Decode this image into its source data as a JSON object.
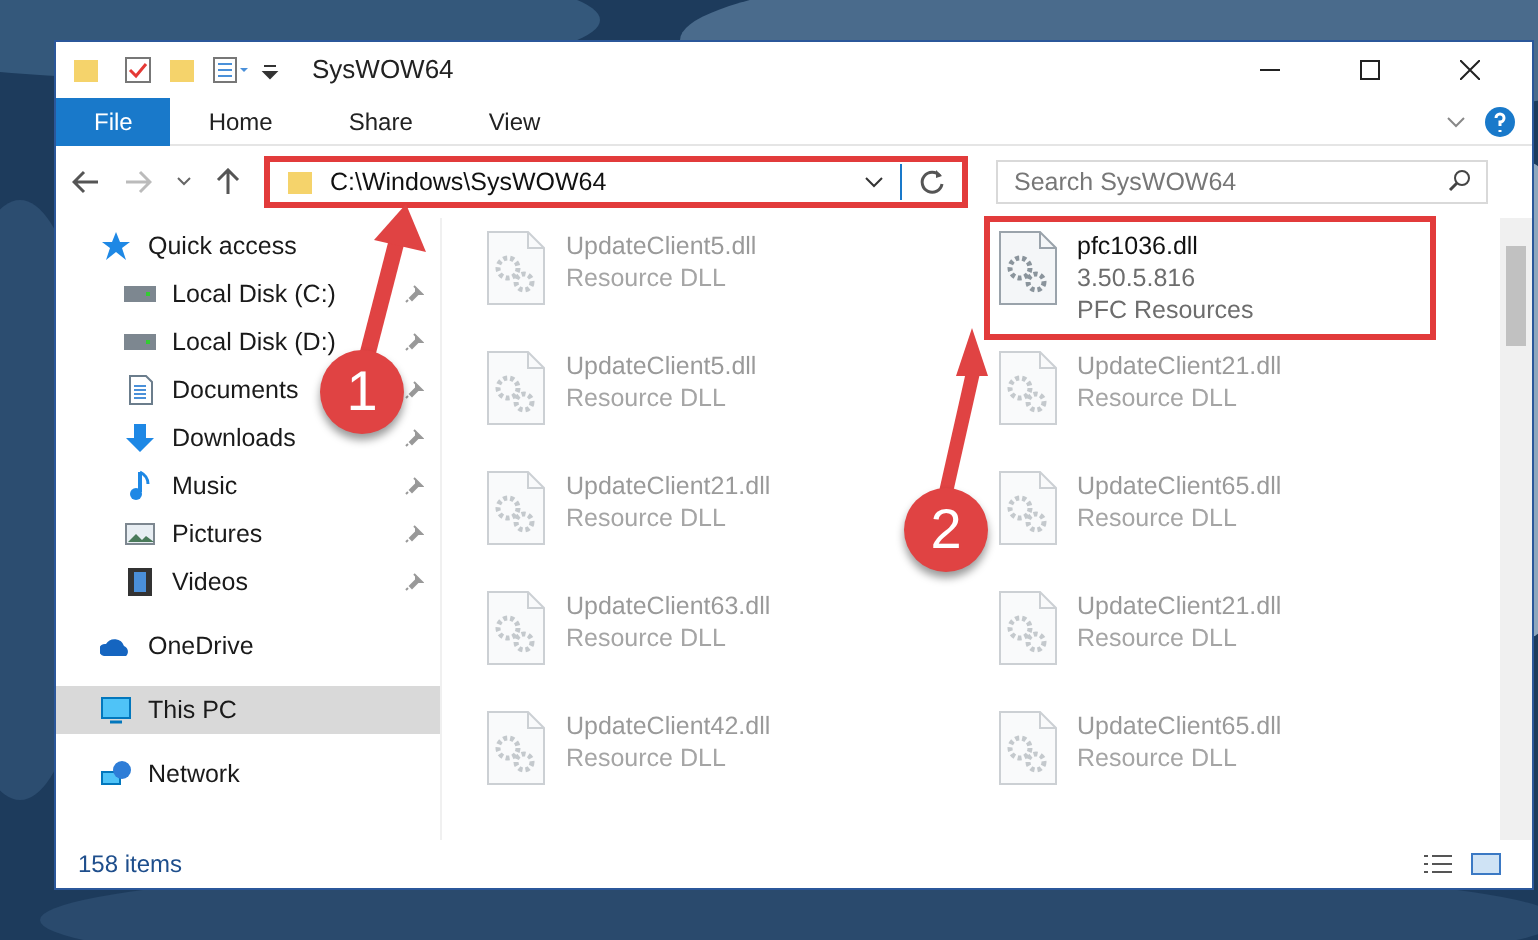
{
  "window": {
    "title": "SysWOW64"
  },
  "ribbon_tabs": [
    {
      "label": "File",
      "selected": true
    },
    {
      "label": "Home",
      "selected": false
    },
    {
      "label": "Share",
      "selected": false
    },
    {
      "label": "View",
      "selected": false
    }
  ],
  "address": {
    "path": "C:\\Windows\\SysWOW64",
    "highlighted": true
  },
  "search": {
    "placeholder": "Search SysWOW64"
  },
  "sidebar": {
    "items": [
      {
        "label": "Quick access",
        "kind": "star",
        "selected": false,
        "pinned": false,
        "children": [
          {
            "label": "Local Disk (C:)",
            "kind": "drive",
            "selected": false,
            "pinned": true
          },
          {
            "label": "Local Disk (D:)",
            "kind": "drive",
            "selected": false,
            "pinned": true
          },
          {
            "label": "Documents",
            "kind": "doc",
            "selected": false,
            "pinned": true
          },
          {
            "label": "Downloads",
            "kind": "download",
            "selected": false,
            "pinned": true
          },
          {
            "label": "Music",
            "kind": "music",
            "selected": false,
            "pinned": true
          },
          {
            "label": "Pictures",
            "kind": "pictures",
            "selected": false,
            "pinned": true
          },
          {
            "label": "Videos",
            "kind": "videos",
            "selected": false,
            "pinned": true
          }
        ]
      },
      {
        "label": "OneDrive",
        "kind": "cloud",
        "selected": false,
        "pinned": false
      },
      {
        "label": "This PC",
        "kind": "pc",
        "selected": true,
        "pinned": false
      },
      {
        "label": "Network",
        "kind": "network",
        "selected": false,
        "pinned": false
      }
    ]
  },
  "files": [
    {
      "name": "UpdateClient5.dll",
      "details": [
        "Resource DLL"
      ],
      "highlighted": false
    },
    {
      "name": "pfc1036.dll",
      "details": [
        "3.50.5.816",
        "PFC Resources"
      ],
      "highlighted": true
    },
    {
      "name": "UpdateClient5.dll",
      "details": [
        "Resource DLL"
      ],
      "highlighted": false
    },
    {
      "name": "UpdateClient21.dll",
      "details": [
        "Resource DLL"
      ],
      "highlighted": false
    },
    {
      "name": "UpdateClient21.dll",
      "details": [
        "Resource DLL"
      ],
      "highlighted": false
    },
    {
      "name": "UpdateClient65.dll",
      "details": [
        "Resource DLL"
      ],
      "highlighted": false
    },
    {
      "name": "UpdateClient63.dll",
      "details": [
        "Resource DLL"
      ],
      "highlighted": false
    },
    {
      "name": "UpdateClient21.dll",
      "details": [
        "Resource DLL"
      ],
      "highlighted": false
    },
    {
      "name": "UpdateClient42.dll",
      "details": [
        "Resource DLL"
      ],
      "highlighted": false
    },
    {
      "name": "UpdateClient65.dll",
      "details": [
        "Resource DLL"
      ],
      "highlighted": false
    }
  ],
  "status_bar": {
    "count": "158 items"
  },
  "annotations": [
    {
      "number": "1"
    },
    {
      "number": "2"
    }
  ]
}
